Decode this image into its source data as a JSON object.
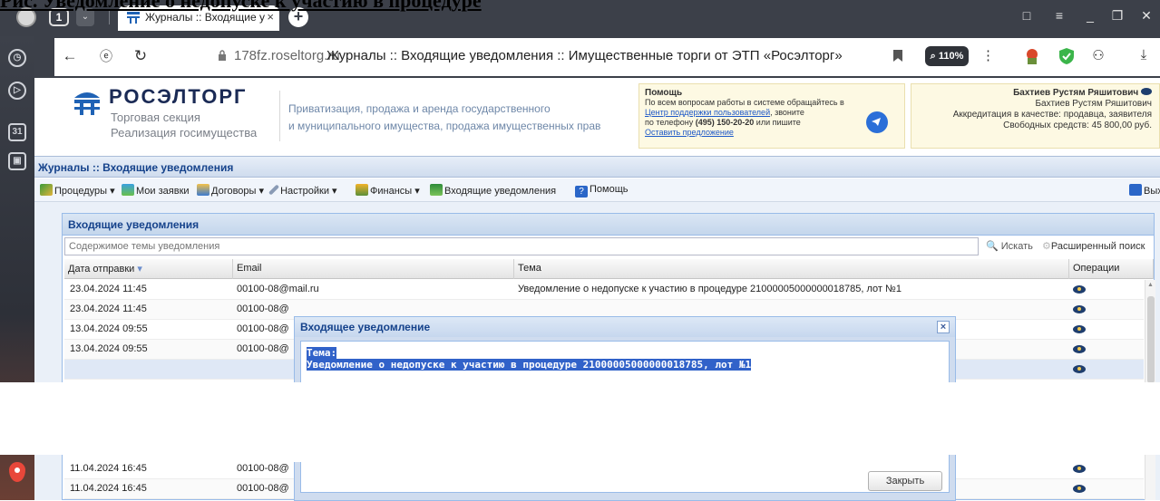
{
  "doc_caption": "Рис. Уведомление о недопуске к участию в процедуре",
  "browser": {
    "tab_count": "1",
    "tab_title": "Журналы :: Входящие у",
    "url_host": "178fz.roseltorg.ru",
    "page_title": "Журналы :: Входящие уведомления :: Имущественные торги от ЭТП «Росэлторг»",
    "zoom": "110%"
  },
  "sidebar": {
    "calendar_label": "31"
  },
  "site": {
    "logo_title": "РОСЭЛТОРГ",
    "logo_sub1": "Торговая секция",
    "logo_sub2": "Реализация госимущества",
    "tagline1": "Приватизация, продажа и аренда государственного",
    "tagline2": "и муниципального имущества, продажа имущественных прав",
    "help": {
      "title": "Помощь",
      "line1": "По всем вопросам работы в системе обращайтесь в",
      "support_link": "Центр поддержки пользователей",
      "line2_suffix": ", звоните",
      "line3_prefix": "по телефону ",
      "phone": "(495) 150-20-20",
      "line3_suffix": " или пишите",
      "suggest_link": "Оставить предложение"
    },
    "user": {
      "name_bold": "Бахтиев Рустям Ряшитович",
      "name": "Бахтиев Рустям Ряшитович",
      "accreditation": "Аккредитация в качестве: продавца, заявителя",
      "funds": "Свободных средств: 45 800,00 руб."
    }
  },
  "journal_title": "Журналы :: Входящие уведомления",
  "menu": {
    "procedures": "Процедуры",
    "my_bids": "Мои заявки",
    "contracts": "Договоры",
    "settings": "Настройки",
    "finance": "Финансы",
    "incoming": "Входящие уведомления",
    "help": "Помощь",
    "exit": "Вых"
  },
  "panel": {
    "title": "Входящие уведомления",
    "search_placeholder": "Содержимое темы уведомления",
    "search_button": "Искать",
    "advanced_search": "Расширенный поиск",
    "columns": [
      "Дата отправки",
      "Email",
      "Тема",
      "Операции"
    ],
    "rows": [
      {
        "date": "23.04.2024 11:45",
        "email": "00100-08@mail.ru",
        "subject": "Уведомление о недопуске к участию в процедуре 21000005000000018785, лот №1"
      },
      {
        "date": "23.04.2024 11:45",
        "email": "00100-08@",
        "subject": ""
      },
      {
        "date": "13.04.2024 09:55",
        "email": "00100-08@",
        "subject": ""
      },
      {
        "date": "13.04.2024 09:55",
        "email": "00100-08@",
        "subject": ""
      },
      {
        "date": "",
        "email": "",
        "subject": ""
      },
      {
        "date": "11.04.2024 16:45",
        "email": "00100-08@",
        "subject": ""
      },
      {
        "date": "11.04.2024 16:45",
        "email": "00100-08@",
        "subject": ""
      }
    ]
  },
  "dialog": {
    "title": "Входящее уведомление",
    "subject_label": "Тема:",
    "subject": "Уведомление о недопуске к участию в процедуре 21000005000000018785, лот №1",
    "close_button": "Закрыть"
  },
  "colors": {
    "chrome": "#3c4049",
    "panel_header_text": "#15428b",
    "selection": "#3162c9"
  }
}
